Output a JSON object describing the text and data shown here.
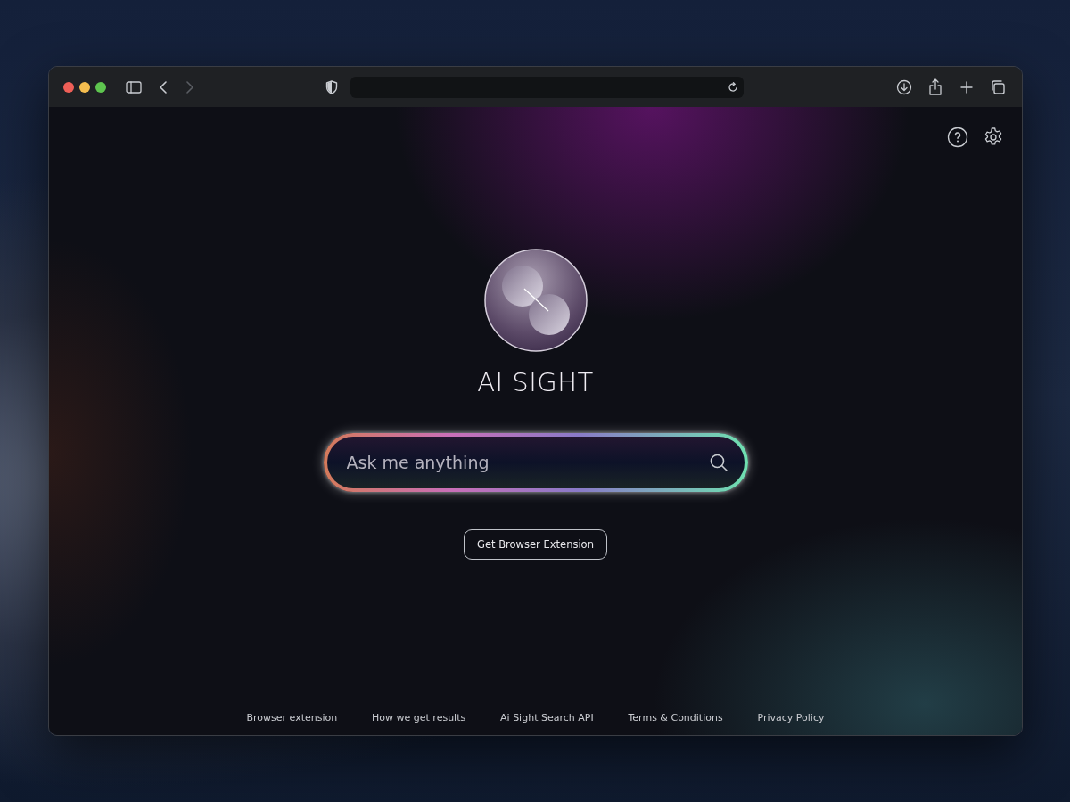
{
  "toolbar": {
    "nav": [
      {
        "kind": "back",
        "disabled": false
      },
      {
        "kind": "forward",
        "disabled": true
      }
    ]
  },
  "brand": {
    "title": "AI SIGHT"
  },
  "search": {
    "placeholder": "Ask me anything"
  },
  "cta": {
    "label": "Get Browser Extension"
  },
  "footer": {
    "links": [
      "Browser extension",
      "How we get results",
      "Ai Sight Search API",
      "Terms & Conditions",
      "Privacy Policy"
    ]
  }
}
